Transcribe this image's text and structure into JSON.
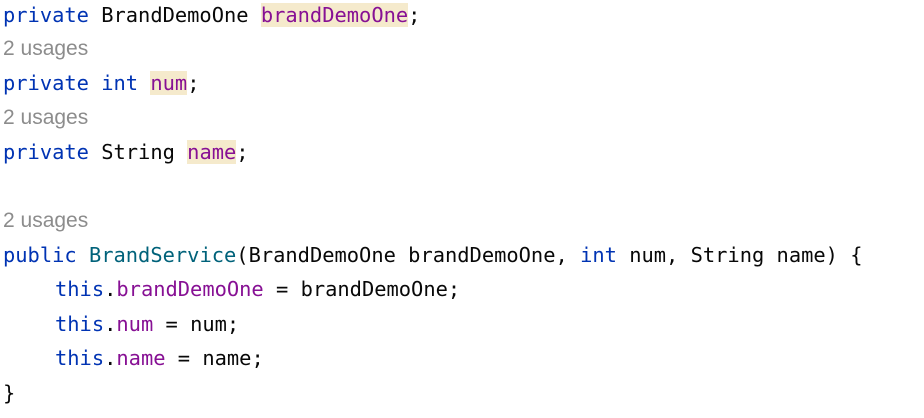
{
  "code": {
    "line1": {
      "kw": "private",
      "type": "BrandDemoOne",
      "field": "brandDemoOne",
      "semi": ";"
    },
    "hint1": "2 usages",
    "line2": {
      "kw": "private",
      "type": "int",
      "field": "num",
      "semi": ";"
    },
    "hint2": "2 usages",
    "line3": {
      "kw": "private",
      "type": "String",
      "field": "name",
      "semi": ";"
    },
    "hint3": "2 usages",
    "ctor": {
      "kw": "public",
      "name": "BrandService",
      "open": "(",
      "p1_type": "BrandDemoOne",
      "p1_name": "brandDemoOne",
      "comma1": ",",
      "p2_type": "int",
      "p2_name": "num",
      "comma2": ",",
      "p3_type": "String",
      "p3_name": "name",
      "close": ")",
      "brace": "{"
    },
    "assign1": {
      "this": "this",
      "dot": ".",
      "field": "brandDemoOne",
      "eq": "=",
      "value": "brandDemoOne",
      "semi": ";"
    },
    "assign2": {
      "this": "this",
      "dot": ".",
      "field": "num",
      "eq": "=",
      "value": "num",
      "semi": ";"
    },
    "assign3": {
      "this": "this",
      "dot": ".",
      "field": "name",
      "eq": "=",
      "value": "name",
      "semi": ";"
    },
    "closing": "}"
  },
  "colors": {
    "keyword": "#0033b3",
    "method": "#00627a",
    "field": "#871094",
    "text": "#080808",
    "hint": "#8c8c8c",
    "highlight": "#f5eacc"
  }
}
